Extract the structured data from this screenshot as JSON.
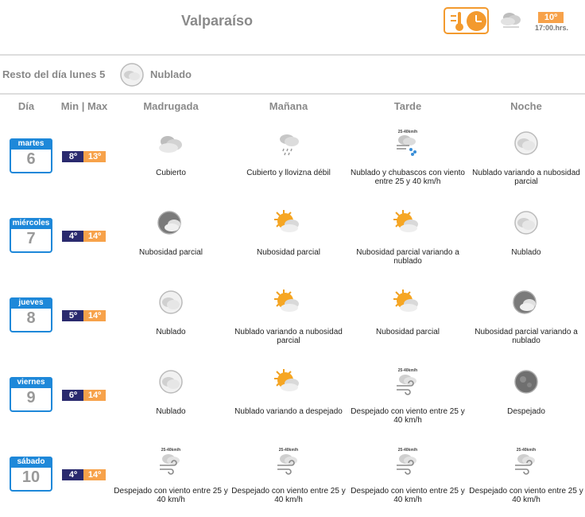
{
  "header": {
    "city": "Valparaíso",
    "current_temp": "10º",
    "current_time": "17:00.hrs.",
    "current_icon": "cloud-icon"
  },
  "rest_of_day": {
    "label": "Resto del día lunes 5",
    "state": "Nublado",
    "icon": "cloud-icon"
  },
  "columns": {
    "day": "Día",
    "minmax": "Min | Max",
    "madrugada": "Madrugada",
    "manana": "Mañana",
    "tarde": "Tarde",
    "noche": "Noche"
  },
  "colors": {
    "accent": "#f39a2e",
    "calendar_blue": "#1e88d9",
    "min_bg": "#2a2a6e",
    "max_bg": "#f7a24a"
  },
  "days": [
    {
      "weekday": "martes",
      "date": "6",
      "min": "8º",
      "max": "13º",
      "periods": [
        {
          "icon": "overcast-icon",
          "text": "Cubierto"
        },
        {
          "icon": "drizzle-icon",
          "text": "Cubierto y llovizna débil"
        },
        {
          "icon": "wind-showers-icon",
          "text": "Nublado y chubascos con viento entre 25 y 40 km/h"
        },
        {
          "icon": "night-cloud-icon",
          "text": "Nublado variando a nubosidad parcial"
        }
      ]
    },
    {
      "weekday": "miércoles",
      "date": "7",
      "min": "4º",
      "max": "14º",
      "periods": [
        {
          "icon": "night-partly-cloudy-icon",
          "text": "Nubosidad parcial"
        },
        {
          "icon": "sun-cloud-icon",
          "text": "Nubosidad parcial"
        },
        {
          "icon": "sun-cloud-icon",
          "text": "Nubosidad parcial variando a nublado"
        },
        {
          "icon": "night-cloud-icon",
          "text": "Nublado"
        }
      ]
    },
    {
      "weekday": "jueves",
      "date": "8",
      "min": "5º",
      "max": "14º",
      "periods": [
        {
          "icon": "night-cloud-icon",
          "text": "Nublado"
        },
        {
          "icon": "sun-cloud-icon",
          "text": "Nublado variando a nubosidad parcial"
        },
        {
          "icon": "sun-cloud-icon",
          "text": "Nubosidad parcial"
        },
        {
          "icon": "night-partly-cloudy-icon",
          "text": "Nubosidad parcial variando a nublado"
        }
      ]
    },
    {
      "weekday": "viernes",
      "date": "9",
      "min": "6º",
      "max": "14º",
      "periods": [
        {
          "icon": "night-cloud-icon",
          "text": "Nublado"
        },
        {
          "icon": "sun-cloud-icon",
          "text": "Nublado variando a despejado"
        },
        {
          "icon": "wind-icon",
          "text": "Despejado con viento entre 25 y 40 km/h"
        },
        {
          "icon": "clear-night-icon",
          "text": "Despejado"
        }
      ]
    },
    {
      "weekday": "sábado",
      "date": "10",
      "min": "4º",
      "max": "14º",
      "periods": [
        {
          "icon": "wind-icon",
          "text": "Despejado con viento entre 25 y 40 km/h"
        },
        {
          "icon": "wind-icon",
          "text": "Despejado con viento entre 25 y 40 km/h"
        },
        {
          "icon": "wind-icon",
          "text": "Despejado con viento entre 25 y 40 km/h"
        },
        {
          "icon": "wind-icon",
          "text": "Despejado con viento entre 25 y 40 km/h"
        }
      ]
    }
  ],
  "wind_badge": "25-40km/h"
}
